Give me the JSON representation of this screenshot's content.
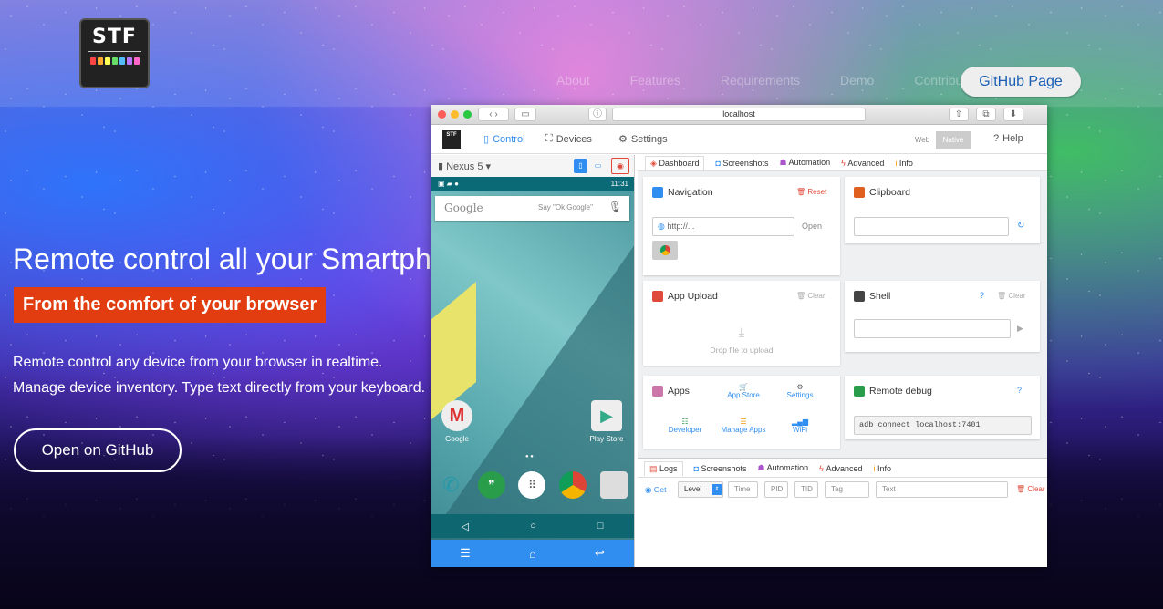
{
  "header": {
    "logo_text": "STF",
    "nav": [
      "About",
      "Features",
      "Requirements",
      "Demo",
      "Contribute"
    ],
    "github_page_label": "GitHub Page"
  },
  "hero": {
    "title": "Remote control all your Smartphone devices",
    "subtitle": "From the comfort of your browser",
    "line1": "Remote control any device from your browser in realtime.",
    "line2": "Manage device inventory. Type text directly from your keyboard.",
    "cta": "Open on GitHub"
  },
  "browser": {
    "url": "localhost",
    "app": {
      "logo": "STF",
      "control": "Control",
      "devices": "Devices",
      "settings": "Settings",
      "web": "Web",
      "native": "Native",
      "help": "Help"
    },
    "device": {
      "name": "Nexus 5",
      "time": "11:31",
      "google": "Google",
      "ok_google": "Say \"Ok Google\"",
      "app_gmail": "Google",
      "app_playstore": "Play Store"
    },
    "tabs": [
      "Dashboard",
      "Screenshots",
      "Automation",
      "Advanced",
      "Info"
    ],
    "cards": {
      "navigation": {
        "title": "Navigation",
        "reset": "Reset",
        "placeholder": "http://...",
        "open": "Open"
      },
      "clipboard": {
        "title": "Clipboard"
      },
      "app_upload": {
        "title": "App Upload",
        "clear": "Clear",
        "drop": "Drop file to upload"
      },
      "shell": {
        "title": "Shell",
        "clear": "Clear"
      },
      "apps": {
        "title": "Apps",
        "items": [
          "App Store",
          "Settings",
          "Developer",
          "Manage Apps",
          "WiFi"
        ]
      },
      "remote_debug": {
        "title": "Remote debug",
        "command": "adb connect localhost:7401"
      }
    },
    "lower_tabs": [
      "Logs",
      "Screenshots",
      "Automation",
      "Advanced",
      "Info"
    ],
    "logs": {
      "get": "Get",
      "level": "Level",
      "time": "Time",
      "pid": "PID",
      "tid": "TID",
      "tag": "Tag",
      "text": "Text",
      "clear": "Clear"
    }
  }
}
